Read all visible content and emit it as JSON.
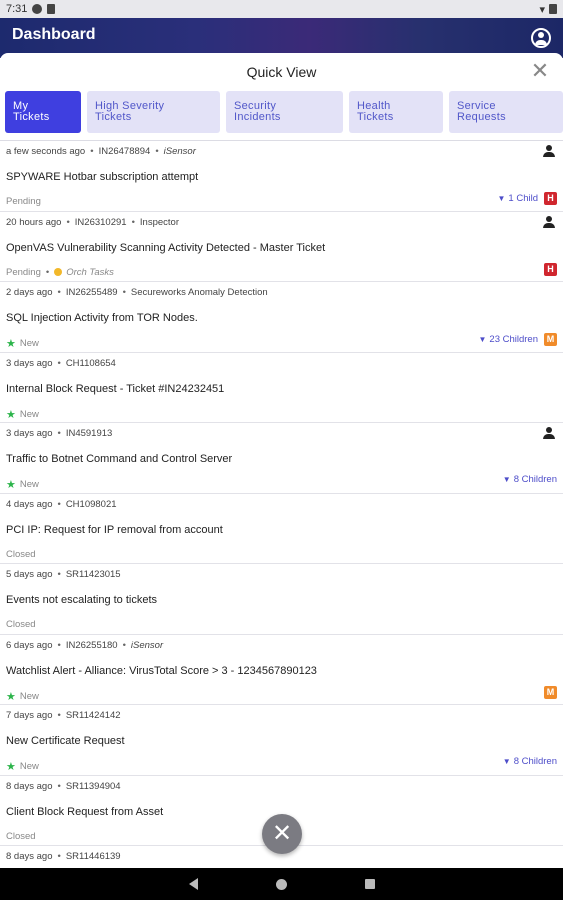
{
  "status_bar": {
    "time": "7:31"
  },
  "app_bar": {
    "title": "Dashboard",
    "account_icon": "account-circle-icon"
  },
  "sheet": {
    "title": "Quick View",
    "close_icon": "close-icon"
  },
  "tabs": [
    {
      "line1": "My",
      "line2": "Tickets",
      "active": true
    },
    {
      "line1": "High Severity",
      "line2": "Tickets",
      "active": false
    },
    {
      "line1": "Security",
      "line2": "Incidents",
      "active": false
    },
    {
      "line1": "Health",
      "line2": "Tickets",
      "active": false
    },
    {
      "line1": "Service",
      "line2": "Requests",
      "active": false
    }
  ],
  "tickets": [
    {
      "age": "a few seconds ago",
      "id": "IN26478894",
      "source": "iSensor",
      "subject": "SPYWARE Hotbar subscription attempt",
      "status": "Pending",
      "children": "1 Child",
      "severity": "H"
    },
    {
      "age": "20 hours ago",
      "id": "IN26310291",
      "source": "Inspector",
      "subject": "OpenVAS Vulnerability Scanning Activity Detected - Master Ticket",
      "status": "Pending",
      "orch": "Orch Tasks",
      "children": "",
      "severity": "H"
    },
    {
      "age": "2 days ago",
      "id": "IN26255489",
      "source": "Secureworks Anomaly Detection",
      "subject": "SQL Injection Activity from TOR Nodes.",
      "status": "New",
      "children": "23 Children",
      "severity": "M"
    },
    {
      "age": "3 days ago",
      "id": "CH1108654",
      "source": "",
      "subject": "Internal Block Request - Ticket #IN24232451",
      "status": "New",
      "children": "",
      "severity": ""
    },
    {
      "age": "3 days ago",
      "id": "IN4591913",
      "source": "",
      "subject": "Traffic to Botnet Command and Control Server",
      "status": "New",
      "children": "8 Children",
      "severity": ""
    },
    {
      "age": "4 days ago",
      "id": "CH1098021",
      "source": "",
      "subject": "PCI IP: Request for IP removal from account",
      "status": "Closed",
      "children": "",
      "severity": ""
    },
    {
      "age": "5 days ago",
      "id": "SR11423015",
      "source": "",
      "subject": "Events not escalating to tickets",
      "status": "Closed",
      "children": "",
      "severity": ""
    },
    {
      "age": "6 days ago",
      "id": "IN26255180",
      "source": "iSensor",
      "subject": "Watchlist Alert - Alliance: VirusTotal Score > 3 - 1234567890123",
      "status": "New",
      "children": "",
      "severity": "M"
    },
    {
      "age": "7 days ago",
      "id": "SR11424142",
      "source": "",
      "subject": "New Certificate Request",
      "status": "New",
      "children": "8 Children",
      "severity": ""
    },
    {
      "age": "8 days ago",
      "id": "SR11394904",
      "source": "",
      "subject": "Client Block Request from Asset",
      "status": "Closed",
      "children": "",
      "severity": ""
    },
    {
      "age": "8 days ago",
      "id": "SR11446139",
      "source": "",
      "subject": "",
      "status": "",
      "children": "",
      "severity": ""
    }
  ],
  "fab": {
    "icon": "close-icon",
    "glyph": "✕"
  },
  "colors": {
    "accent": "#3f3fe0",
    "tab_bg": "#e3e2f7",
    "sev_high": "#d0262e",
    "sev_medium": "#f08b2a",
    "new_star": "#2bb44a"
  }
}
